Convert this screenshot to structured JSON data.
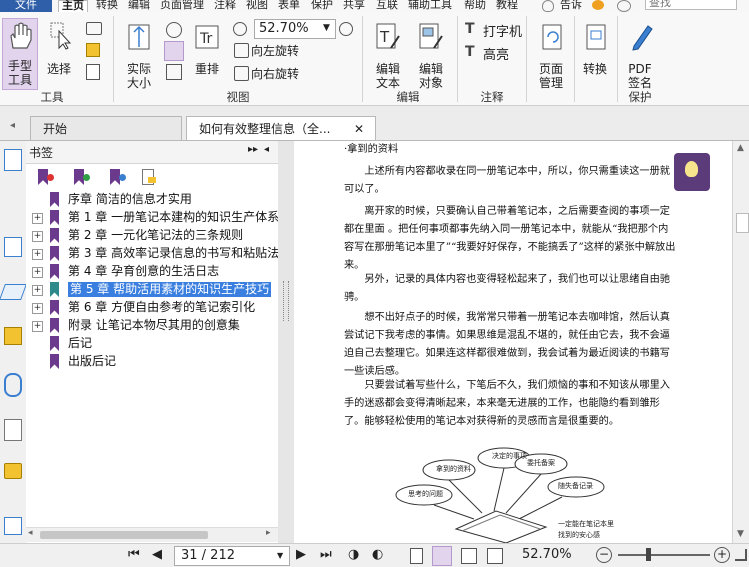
{
  "menubar": {
    "file": "文件",
    "items": [
      "主页",
      "转换",
      "编辑",
      "页面管理",
      "注释",
      "视图",
      "表单",
      "保护",
      "共享",
      "互联",
      "辅助工具",
      "帮助",
      "教程"
    ],
    "tell_me": "告诉",
    "search_placeholder": "查找"
  },
  "ribbon": {
    "hand_tool": "手型\n工具",
    "select": "选择",
    "actual_size": "实际\n大小",
    "reflow": "重排",
    "zoom_value": "52.70%",
    "rotate_left": "向左旋转",
    "rotate_right": "向右旋转",
    "edit_text": "编辑\n文本",
    "edit_object": "编辑\n对象",
    "typewriter": "打字机",
    "highlight": "高亮",
    "page_manage": "页面\n管理",
    "convert": "转换",
    "pdf_sign": "PDF\n签名",
    "groups": [
      "工具",
      "视图",
      "编辑",
      "注释",
      "保护"
    ]
  },
  "tabs": [
    {
      "label": "开始"
    },
    {
      "label": "如何有效整理信息（全..."
    }
  ],
  "bookmarks": {
    "title": "书签",
    "items": [
      {
        "label": "序章 简洁的信息才实用",
        "expandable": false
      },
      {
        "label": "第 1 章 一册笔记本建构的知识生产体系",
        "expandable": true
      },
      {
        "label": "第 2 章 一元化笔记法的三条规则",
        "expandable": true
      },
      {
        "label": "第 3 章 高效率记录信息的书写和粘贴法",
        "expandable": true
      },
      {
        "label": "第 4 章 孕育创意的生活日志",
        "expandable": true
      },
      {
        "label": "第 5 章 帮助活用素材的知识生产技巧",
        "expandable": true,
        "selected": true
      },
      {
        "label": "第 6 章 方便自由参考的笔记索引化",
        "expandable": true
      },
      {
        "label": "附录 让笔记本物尽其用的创意集",
        "expandable": true
      },
      {
        "label": "后记",
        "expandable": false
      },
      {
        "label": "出版后记",
        "expandable": false
      }
    ]
  },
  "document": {
    "paragraphs": [
      "·拿到的资料",
      "　　上述所有内容都收录在同一册笔记本中，所以，你只需重读这一册就可以了。",
      "　　离开家的时候，只要确认自己带着笔记本，之后需要查阅的事项一定都在里面 。把任何事项都事先纳入同一册笔记本中，就能从“我把那个内容写在那册笔记本里了”“我要好好保存，不能搞丢了”这样的紧张中解放出来。",
      "　　另外，记录的具体内容也变得轻松起来了，我们也可以让思绪自由驰骋。",
      "　　想不出好点子的时候，我常常只带着一册笔记本去咖啡馆，然后认真尝试记下我考虑的事情。如果思维是混乱不堪的，就任由它去，我不会逼迫自己去整理它。如果连这样都很难做到，我会试着为最近阅读的书籍写一些读后感。",
      "　　只要尝试着写些什么，下笔后不久，我们烦恼的事和不知该从哪里入手的迷惑都会变得清晰起来，本来毫无进展的工作，也能隐约看到雏形了。能够轻松使用的笔记本对获得新的灵感而言是很重要的。"
    ],
    "illustration_bubbles": [
      "决定的事项",
      "拿到的资料",
      "委托备案",
      "思考的问题",
      "随失备记录"
    ],
    "illustration_caption": "一定能在笔记本里\n找到的安心感"
  },
  "statusbar": {
    "page_display": "31 / 212",
    "zoom": "52.70%"
  },
  "colors": {
    "accent": "#2f5fa8",
    "bookmark_icon": "#6b3a8c",
    "selection": "#3a7fe0",
    "hand_active": "#e3d4ee",
    "tip_badge": "#5b3b7a"
  }
}
